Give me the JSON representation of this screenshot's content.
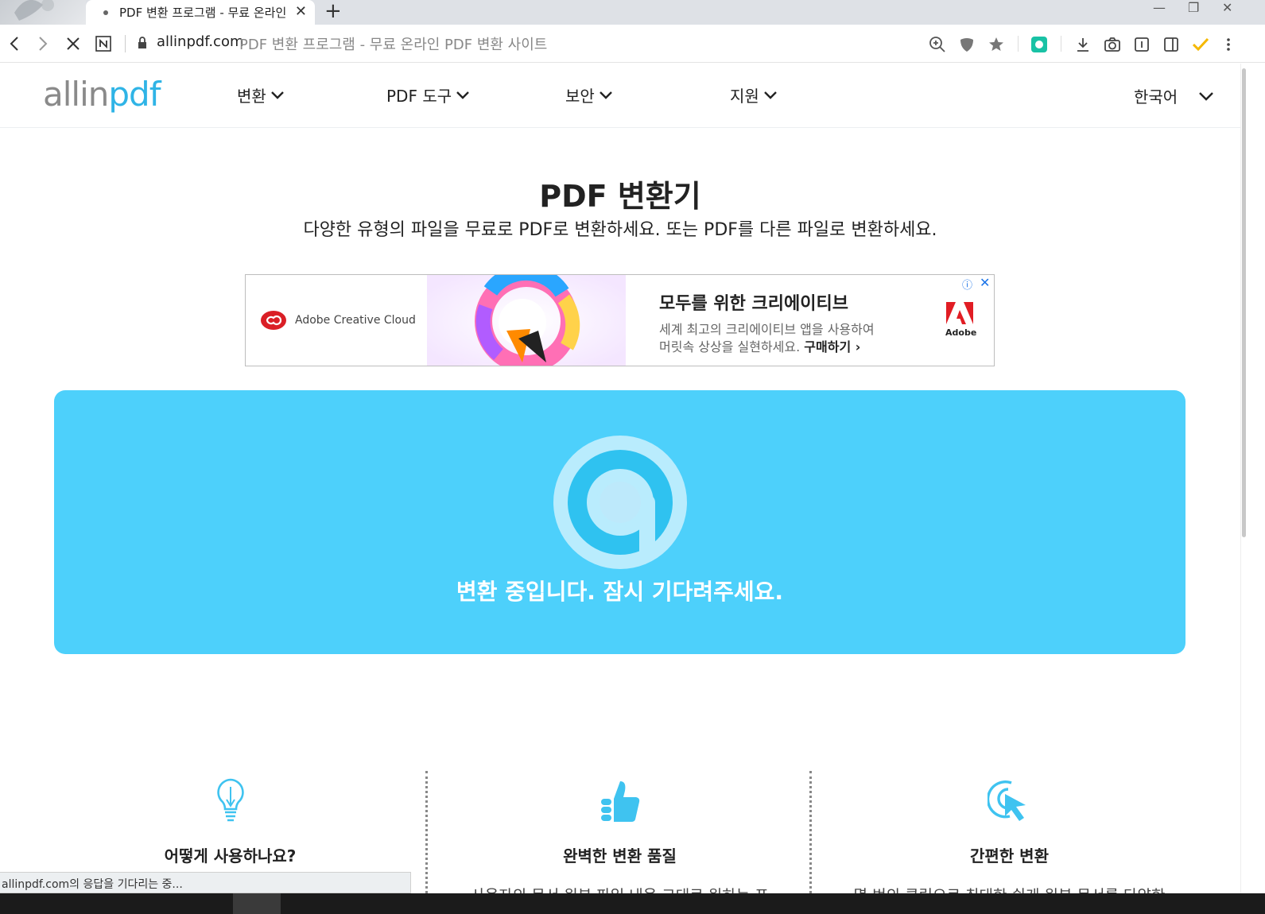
{
  "browser": {
    "tab_title": "PDF 변환 프로그램 - 무료 온라인 PDF 변환 사이트",
    "url_host": "allinpdf.com",
    "url_title": "PDF 변환 프로그램 - 무료 온라인 PDF 변환 사이트",
    "status_text": "allinpdf.com의 응답을 기다리는 중..."
  },
  "header": {
    "logo_a": "allin",
    "logo_b": "pdf",
    "menu": [
      {
        "label": "변환"
      },
      {
        "label": "PDF 도구"
      },
      {
        "label": "보안"
      },
      {
        "label": "지원"
      }
    ],
    "language": "한국어"
  },
  "hero": {
    "title": "PDF 변환기",
    "subtitle": "다양한 유형의 파일을 무료로 PDF로 변환하세요. 또는 PDF를 다른 파일로 변환하세요."
  },
  "ad": {
    "brand": "Adobe Creative Cloud",
    "headline": "모두를 위한 크리에이티브",
    "line1": "세계 최고의 크리에이티브 앱을 사용하여",
    "line2": "머릿속 상상을 실현하세요.",
    "cta": "구매하기 ›",
    "adobe": "Adobe"
  },
  "converting": {
    "message": "변환 중입니다. 잠시 기다려주세요."
  },
  "features": [
    {
      "title": "어떻게 사용하나요?",
      "desc": ""
    },
    {
      "title": "완벽한 변환 품질",
      "desc": "사용자의 문서 원본 파일 내용 그대로 원하는 포"
    },
    {
      "title": "간편한 변환",
      "desc": "몇 번의 클릭으로 최대한 쉽게 원본 문서를 다양한"
    }
  ],
  "colors": {
    "accent": "#4dd0fb",
    "logo_accent": "#2fb4e6"
  }
}
